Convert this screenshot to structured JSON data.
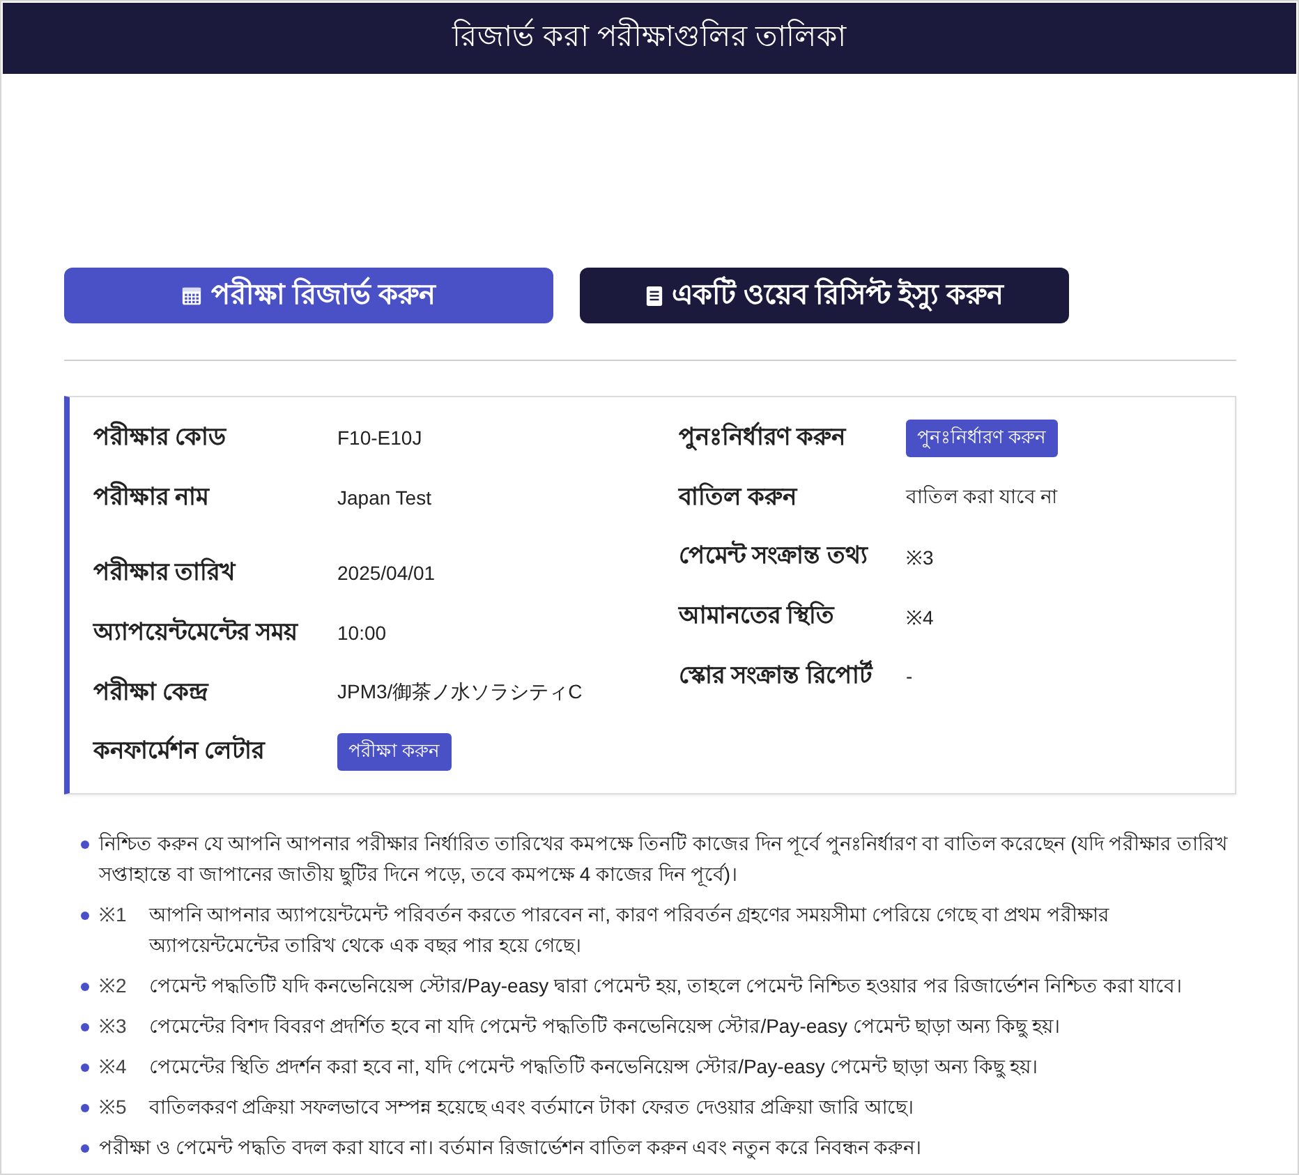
{
  "header": {
    "title": "রিজার্ভ করা পরীক্ষাগুলির তালিকা"
  },
  "actions": [
    {
      "label": "পরীক্ষা রিজার্ভ করুন",
      "kind": "reserve"
    },
    {
      "label": "একটি ওয়েব রিসিপ্ট ইস্যু করুন",
      "kind": "receipt"
    }
  ],
  "details": {
    "left": [
      {
        "label": "পরীক্ষার কোড",
        "value": "F10-E10J",
        "kind": "text"
      },
      {
        "label": "পরীক্ষার নাম",
        "value": "Japan Test",
        "kind": "text"
      },
      {
        "label": "পরীক্ষার তারিখ",
        "value": "2025/04/01",
        "kind": "text"
      },
      {
        "label": "অ্যাপয়েন্টমেন্টের সময়",
        "value": "10:00",
        "kind": "text"
      },
      {
        "label": "পরীক্ষা কেন্দ্র",
        "value": "JPM3/御茶ノ水ソラシティC",
        "kind": "text"
      },
      {
        "label": "কনফার্মেশন লেটার",
        "value": "পরীক্ষা করুন",
        "kind": "button"
      }
    ],
    "right": [
      {
        "label": "পুনঃনির্ধারণ করুন",
        "value": "পুনঃনির্ধারণ করুন",
        "kind": "button"
      },
      {
        "label": "বাতিল করুন",
        "value": "বাতিল করা যাবে না",
        "kind": "text"
      },
      {
        "label": "পেমেন্ট সংক্রান্ত তথ্য",
        "value": "※3",
        "kind": "text"
      },
      {
        "label": "আমানতের স্থিতি",
        "value": "※4",
        "kind": "text"
      },
      {
        "label": "স্কোর সংক্রান্ত রিপোর্ট",
        "value": "-",
        "kind": "text"
      }
    ]
  },
  "notes": [
    {
      "text": "নিশ্চিত করুন যে আপনি আপনার পরীক্ষার নির্ধারিত তারিখের কমপক্ষে তিনটি কাজের দিন পূর্বে পুনঃনির্ধারণ বা বাতিল করেছেন (যদি পরীক্ষার তারিখ সপ্তাহান্তে বা জাপানের জাতীয় ছুটির দিনে পড়ে, তবে কমপক্ষে 4 কাজের দিন পূর্বে)।"
    },
    {
      "mark": "※1",
      "text": "আপনি আপনার অ্যাপয়েন্টমেন্ট পরিবর্তন করতে পারবেন না, কারণ পরিবর্তন গ্রহণের সময়সীমা পেরিয়ে গেছে বা প্রথম পরীক্ষার অ্যাপয়েন্টমেন্টের তারিখ থেকে এক বছর পার হয়ে গেছে।"
    },
    {
      "mark": "※2",
      "text": "পেমেন্ট পদ্ধতিটি যদি কনভেনিয়েন্স স্টোর/Pay-easy দ্বারা পেমেন্ট হয়, তাহলে পেমেন্ট নিশ্চিত হওয়ার পর রিজার্ভেশন নিশ্চিত করা যাবে।"
    },
    {
      "mark": "※3",
      "text": "পেমেন্টের বিশদ বিবরণ প্রদর্শিত হবে না যদি পেমেন্ট পদ্ধতিটি কনভেনিয়েন্স স্টোর/Pay-easy পেমেন্ট ছাড়া অন্য কিছু হয়।"
    },
    {
      "mark": "※4",
      "text": "পেমেন্টের স্থিতি প্রদর্শন করা হবে না, যদি পেমেন্ট পদ্ধতিটি কনভেনিয়েন্স স্টোর/Pay-easy পেমেন্ট ছাড়া অন্য কিছু হয়।"
    },
    {
      "mark": "※5",
      "text": "বাতিলকরণ প্রক্রিয়া সফলভাবে সম্পন্ন হয়েছে এবং বর্তমানে টাকা ফেরত দেওয়ার প্রক্রিয়া জারি আছে।"
    },
    {
      "text": "পরীক্ষা ও পেমেন্ট পদ্ধতি বদল করা যাবে না। বর্তমান রিজার্ভেশন বাতিল করুন এবং নতুন করে নিবন্ধন করুন।"
    }
  ]
}
